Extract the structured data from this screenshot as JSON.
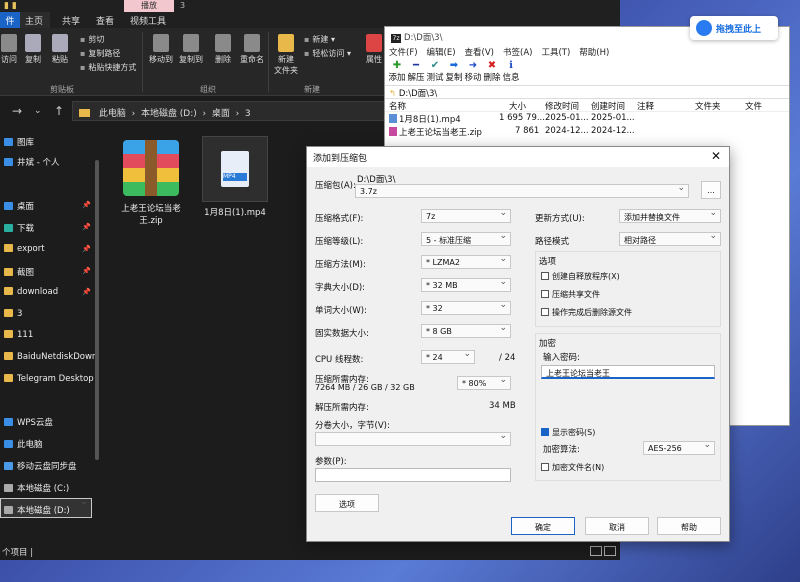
{
  "explorer": {
    "tab_context": "播放",
    "tab_context2": "3",
    "ribbon_tabs": [
      "件",
      "主页",
      "共享",
      "查看",
      "视频工具"
    ],
    "buttons": {
      "pin": "访问",
      "copy": "复制",
      "paste": "粘贴",
      "cut": "剪切",
      "copy_path": "复制路径",
      "paste_shortcut": "粘贴快捷方式",
      "move_to": "移动到",
      "copy_to": "复制到",
      "delete": "删除",
      "rename": "重命名",
      "new_folder": "新建\n文件夹",
      "new_item": "新建 ▾",
      "easy_access": "轻松访问 ▾",
      "props": "属性"
    },
    "groups": {
      "clipboard": "剪贴板",
      "organize": "组织",
      "new": "新建"
    },
    "address": [
      "此电脑",
      "本地磁盘 (D:)",
      "桌面",
      "3"
    ],
    "sidebar": [
      {
        "label": "图库",
        "color": "#3a8ee6",
        "pinned": false
      },
      {
        "label": "井斌 - 个人",
        "color": "#3a8ee6",
        "pinned": false
      },
      {
        "label": "桌面",
        "color": "#3a8ee6",
        "pinned": true
      },
      {
        "label": "下载",
        "color": "#2ab0a0",
        "pinned": true
      },
      {
        "label": "export",
        "color": "#e8b84a",
        "pinned": true
      },
      {
        "label": "截图",
        "color": "#e8b84a",
        "pinned": true
      },
      {
        "label": "download",
        "color": "#e8b84a",
        "pinned": true
      },
      {
        "label": "3",
        "color": "#e8b84a",
        "pinned": false
      },
      {
        "label": "111",
        "color": "#e8b84a",
        "pinned": false
      },
      {
        "label": "BaiduNetdiskDownl",
        "color": "#e8b84a",
        "pinned": false
      },
      {
        "label": "Telegram Desktop",
        "color": "#e8b84a",
        "pinned": false
      },
      {
        "label": "WPS云盘",
        "color": "#3a8ee6",
        "pinned": false
      },
      {
        "label": "此电脑",
        "color": "#3a8ee6",
        "pinned": false
      },
      {
        "label": "移动云盘同步盘",
        "color": "#4a9ae8",
        "pinned": false
      },
      {
        "label": "本地磁盘 (C:)",
        "color": "#aaaaaa",
        "pinned": false
      },
      {
        "label": "本地磁盘 (D:)",
        "color": "#aaaaaa",
        "pinned": false
      }
    ],
    "files": [
      {
        "name": "上老王论坛当老王.zip"
      },
      {
        "name": "1月8日(1).mp4"
      }
    ],
    "mp4_badge": "MP4",
    "status": "个项目 |"
  },
  "fm": {
    "title": "D:\\D面\\3\\",
    "menu": [
      "文件(F)",
      "编辑(E)",
      "查看(V)",
      "书签(A)",
      "工具(T)",
      "帮助(H)"
    ],
    "tools": [
      {
        "sym": "✚",
        "label": "添加",
        "color": "#2a9a2a"
      },
      {
        "sym": "━",
        "label": "解压",
        "color": "#1a3aa0"
      },
      {
        "sym": "✔",
        "label": "测试",
        "color": "#2a8a8a"
      },
      {
        "sym": "➡",
        "label": "复制",
        "color": "#1a6ad8"
      },
      {
        "sym": "➜",
        "label": "移动",
        "color": "#1a4ac8"
      },
      {
        "sym": "✖",
        "label": "删除",
        "color": "#d82020"
      },
      {
        "sym": "ℹ",
        "label": "信息",
        "color": "#1a4ac8"
      }
    ],
    "path": "D:\\D面\\3\\",
    "columns": [
      "名称",
      "大小",
      "修改时间",
      "创建时间",
      "注释",
      "文件夹",
      "文件"
    ],
    "rows": [
      {
        "name": "1月8日(1).mp4",
        "size": "1 695 79...",
        "modified": "2025-01...",
        "created": "2025-01..."
      },
      {
        "name": "上老王论坛当老王.zip",
        "size": "7 861",
        "modified": "2024-12...",
        "created": "2024-12..."
      }
    ]
  },
  "baidu": {
    "label": "拖拽至此上"
  },
  "dialog": {
    "title": "添加到压缩包",
    "archive_label": "压缩包(A):",
    "archive_dir": "D:\\D面\\3\\",
    "archive_name": "3.7z",
    "browse": "...",
    "format_label": "压缩格式(F):",
    "format": "7z",
    "level_label": "压缩等级(L):",
    "level": "5 - 标准压缩",
    "method_label": "压缩方法(M):",
    "method": "* LZMA2",
    "dict_label": "字典大小(D):",
    "dict": "* 32 MB",
    "word_label": "单词大小(W):",
    "word": "* 32",
    "solid_label": "固实数据大小:",
    "solid": "* 8 GB",
    "cpu_label": "CPU 线程数:",
    "cpu": "* 24",
    "cpu_total": "/ 24",
    "mem_label": "压缩所需内存:",
    "mem_detail": "7264 MB / 26 GB / 32 GB",
    "mem": "* 80%",
    "demem_label": "解压所需内存:",
    "demem": "34 MB",
    "split_label": "分卷大小，字节(V):",
    "params_label": "参数(P):",
    "options_btn": "选项",
    "update_label": "更新方式(U):",
    "update": "添加并替换文件",
    "pathmode_label": "路径模式",
    "pathmode": "相对路径",
    "options_title": "选项",
    "opt_sfx": "创建自释放程序(X)",
    "opt_shared": "压缩共享文件",
    "opt_delete": "操作完成后删除源文件",
    "enc_title": "加密",
    "pwd_label": "输入密码:",
    "pwd_value": "上老王论坛当老王",
    "show_pwd": "显示密码(S)",
    "enc_method_label": "加密算法:",
    "enc_method": "AES-256",
    "enc_names": "加密文件名(N)",
    "ok": "确定",
    "cancel": "取消",
    "help": "帮助"
  }
}
